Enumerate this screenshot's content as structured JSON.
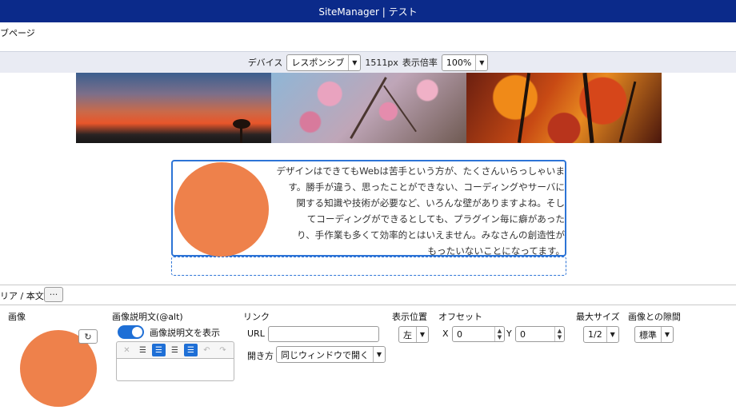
{
  "app": {
    "title": "SiteManager | テスト"
  },
  "page": {
    "name": "ブページ"
  },
  "device_bar": {
    "device_label": "デバイス",
    "device_value": "レスポンシブ",
    "width_text": "1511px",
    "zoom_label": "表示倍率",
    "zoom_value": "100%"
  },
  "content": {
    "text_lines": [
      "デザインはできてもWebは苦手という方が、たくさんいらっしゃいま",
      "す。勝手が違う、思ったことができない、コーディングやサーバに",
      "関する知識や技術が必要など、いろんな壁がありますよね。そし",
      "てコーディングができるとしても、プラグイン毎に癖があった",
      "り、手作業も多くて効率的とはいえません。みなさんの創造性が",
      "もったいないことになってます。"
    ],
    "image_color": "#ee814b"
  },
  "breadcrumb": {
    "text": "リア / 本文",
    "more_label": "···"
  },
  "props": {
    "image_label": "画像",
    "alt_label": "画像説明文(@alt)",
    "alt_toggle_label": "画像説明文を表示",
    "link_label": "リンク",
    "url_label": "URL",
    "url_value": "",
    "open_label": "開き方",
    "open_value": "同じウィンドウで開く",
    "position_label": "表示位置",
    "position_value": "左",
    "offset_label": "オフセット",
    "x_label": "X",
    "x_value": "0",
    "y_label": "Y",
    "y_value": "0",
    "maxsize_label": "最大サイズ",
    "maxsize_value": "1/2",
    "gap_label": "画像との隙間",
    "gap_value": "標準"
  },
  "colors": {
    "titlebar": "#0b2a8a",
    "accent": "#1e6fd6",
    "image": "#ee814b"
  }
}
